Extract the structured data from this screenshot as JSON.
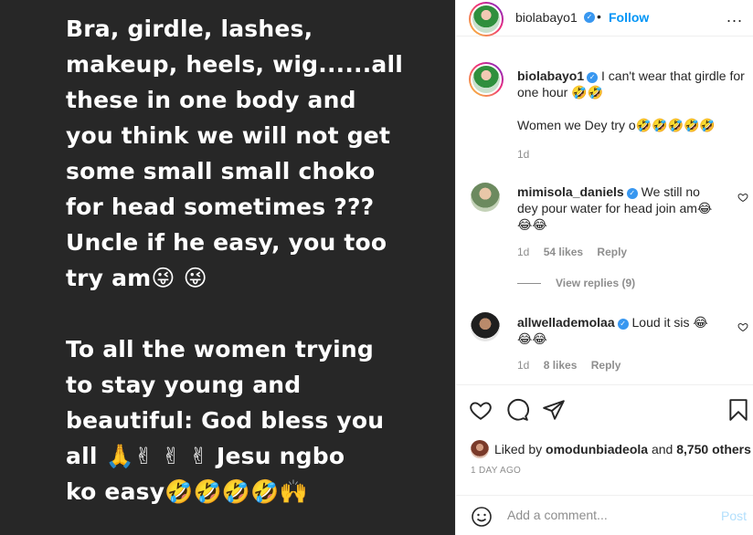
{
  "media": {
    "para1": "Bra, girdle, lashes,\nmakeup, heels, wig......all\nthese in one body and\nyou think we will not get\nsome small small choko\nfor head sometimes ???\nUncle if he easy, you too\ntry am😜 😜",
    "para2": " To all the women trying\nto stay young and\nbeautiful: God bless you\nall 🙏✌ ✌ ✌ Jesu ngbo\nko easy🤣🤣🤣🤣🙌"
  },
  "header": {
    "username": "biolabayo1",
    "dot": "•",
    "follow_label": "Follow",
    "more_icon": "..."
  },
  "caption": {
    "username": "biolabayo1",
    "text": "I can't wear that girdle for one hour 🤣🤣",
    "text2": "Women we Dey try o🤣🤣🤣🤣🤣",
    "time": "1d"
  },
  "comments": [
    {
      "username": "mimisola_daniels",
      "text": "We still no dey pour water for head join am😂😂😂",
      "time": "1d",
      "likes": "54 likes",
      "reply": "Reply",
      "view_replies": "View replies (9)"
    },
    {
      "username": "allwellademolaa",
      "text": "Loud it sis 😂😂😂",
      "time": "1d",
      "likes": "8 likes",
      "reply": "Reply"
    }
  ],
  "likes": {
    "prefix": "Liked by",
    "user": "omodunbiadeola",
    "and": "and",
    "others": "8,750 others"
  },
  "time_ago": "1 DAY AGO",
  "add_comment": {
    "placeholder": "Add a comment...",
    "post_label": "Post"
  },
  "colors": {
    "accent": "#0095f6",
    "verified": "#3897f0",
    "media_bg": "#272727",
    "muted": "#8e8e8e"
  },
  "icons": [
    "heart-icon",
    "comment-icon",
    "share-icon",
    "bookmark-icon",
    "emoji-icon",
    "verified-icon",
    "more-icon"
  ]
}
